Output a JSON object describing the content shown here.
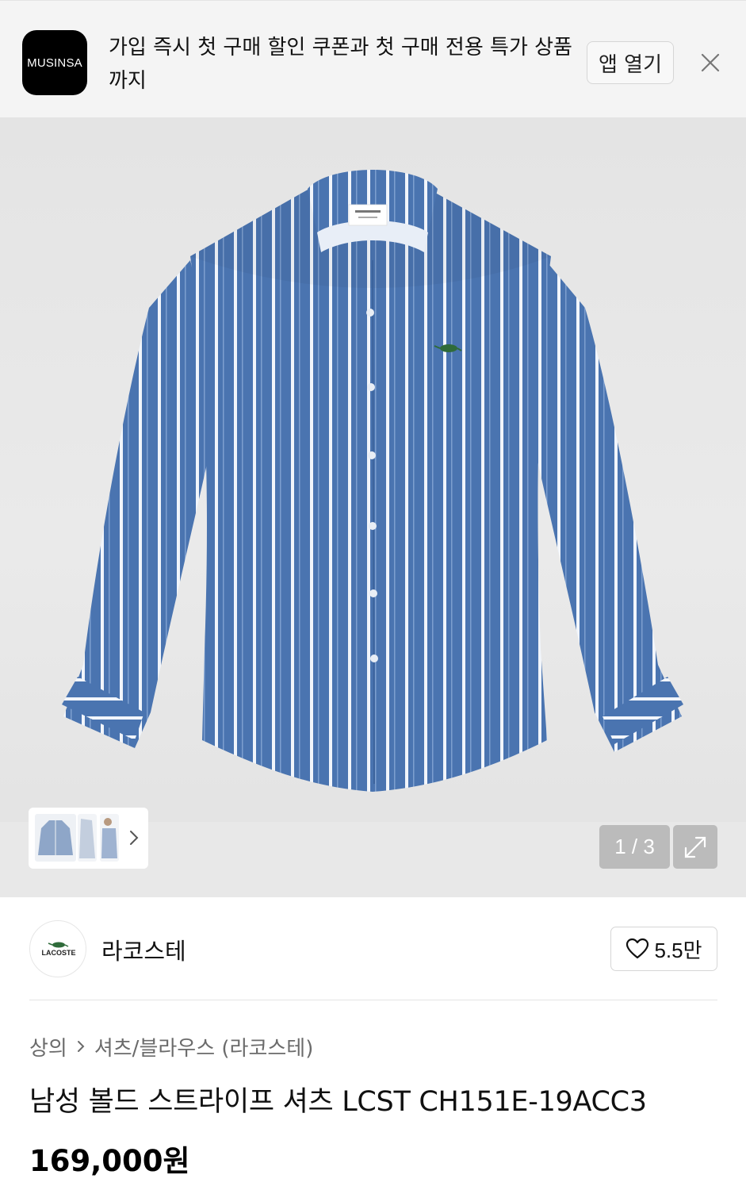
{
  "app_banner": {
    "logo_text": "MUSINSA",
    "message": "가입 즉시 첫 구매 할인 쿠폰과 첫 구매 전용 특가 상품까지",
    "open_app_label": "앱 열기",
    "close_icon": "close-icon"
  },
  "gallery": {
    "counter": "1 / 3",
    "current_index": 1,
    "total": 3,
    "expand_icon": "expand-icon",
    "thumbnail_next_icon": "chevron-right-icon",
    "shirt_color": "#4a74b0",
    "stripe_color": "#ffffff"
  },
  "brand": {
    "name": "라코스테",
    "logo_text": "LACOSTE",
    "like_count": "5.5만",
    "like_icon": "heart-icon"
  },
  "product": {
    "category": "상의",
    "subcategory": "셔츠/블라우스 (라코스테)",
    "title": "남성 볼드 스트라이프 셔츠 LCST CH151E-19ACC3",
    "price": "169,000원"
  }
}
